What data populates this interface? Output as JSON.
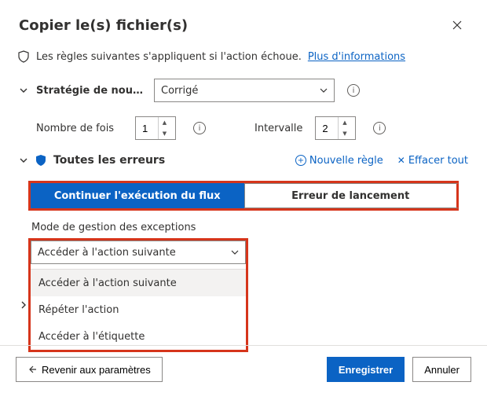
{
  "header": {
    "title": "Copier le(s) fichier(s)"
  },
  "info": {
    "text": "Les règles suivantes s'appliquent si l'action échoue.",
    "link": "Plus d'informations"
  },
  "strategy": {
    "label": "Stratégie de nouv…",
    "selected": "Corrigé"
  },
  "retry": {
    "count_label": "Nombre de fois",
    "count_value": "1",
    "interval_label": "Intervalle",
    "interval_value": "2"
  },
  "errors": {
    "title": "Toutes les erreurs",
    "new_rule": "Nouvelle règle",
    "clear_all": "Effacer tout"
  },
  "tabs": {
    "continue": "Continuer l'exécution du flux",
    "throw": "Erreur de lancement"
  },
  "mode": {
    "label": "Mode de gestion des exceptions",
    "selected": "Accéder à l'action suivante",
    "options": {
      "next": "Accéder à l'action suivante",
      "repeat": "Répéter l'action",
      "label": "Accéder à l'étiquette"
    }
  },
  "footer": {
    "back": "Revenir aux paramètres",
    "save": "Enregistrer",
    "cancel": "Annuler"
  }
}
